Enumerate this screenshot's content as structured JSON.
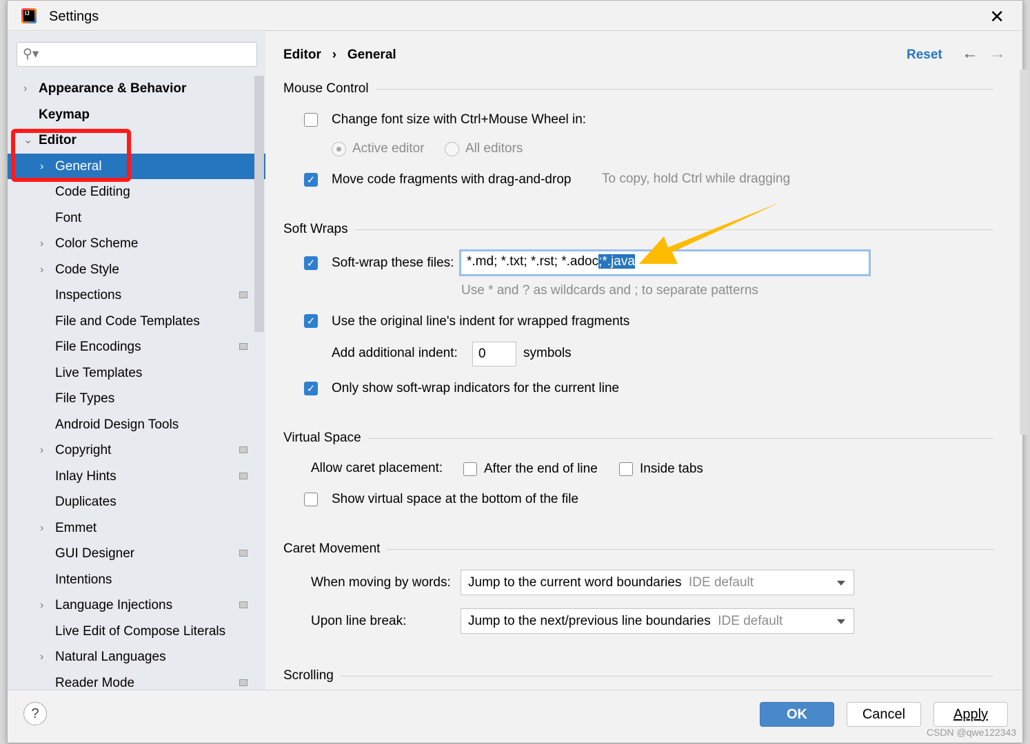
{
  "window": {
    "title": "Settings",
    "close": "✕",
    "logo_text": "IJ"
  },
  "sidebar": {
    "search_placeholder": "",
    "items": [
      {
        "label": "Appearance & Behavior",
        "level": 0,
        "bold": true,
        "arrow": "›"
      },
      {
        "label": "Keymap",
        "level": 0,
        "bold": true,
        "arrow": ""
      },
      {
        "label": "Editor",
        "level": 0,
        "bold": true,
        "arrow": "⌄"
      },
      {
        "label": "General",
        "level": 1,
        "arrow": "›",
        "selected": true
      },
      {
        "label": "Code Editing",
        "level": 1,
        "arrow": ""
      },
      {
        "label": "Font",
        "level": 1,
        "arrow": ""
      },
      {
        "label": "Color Scheme",
        "level": 1,
        "arrow": "›"
      },
      {
        "label": "Code Style",
        "level": 1,
        "arrow": "›"
      },
      {
        "label": "Inspections",
        "level": 1,
        "arrow": "",
        "project": true
      },
      {
        "label": "File and Code Templates",
        "level": 1,
        "arrow": ""
      },
      {
        "label": "File Encodings",
        "level": 1,
        "arrow": "",
        "project": true
      },
      {
        "label": "Live Templates",
        "level": 1,
        "arrow": ""
      },
      {
        "label": "File Types",
        "level": 1,
        "arrow": ""
      },
      {
        "label": "Android Design Tools",
        "level": 1,
        "arrow": ""
      },
      {
        "label": "Copyright",
        "level": 1,
        "arrow": "›",
        "project": true
      },
      {
        "label": "Inlay Hints",
        "level": 1,
        "arrow": "",
        "project": true
      },
      {
        "label": "Duplicates",
        "level": 1,
        "arrow": ""
      },
      {
        "label": "Emmet",
        "level": 1,
        "arrow": "›"
      },
      {
        "label": "GUI Designer",
        "level": 1,
        "arrow": "",
        "project": true
      },
      {
        "label": "Intentions",
        "level": 1,
        "arrow": ""
      },
      {
        "label": "Language Injections",
        "level": 1,
        "arrow": "›",
        "project": true
      },
      {
        "label": "Live Edit of Compose Literals",
        "level": 1,
        "arrow": ""
      },
      {
        "label": "Natural Languages",
        "level": 1,
        "arrow": "›"
      },
      {
        "label": "Reader Mode",
        "level": 1,
        "arrow": "",
        "project": true
      }
    ]
  },
  "header": {
    "crumb1": "Editor",
    "sep": "›",
    "crumb2": "General",
    "reset": "Reset",
    "back": "←",
    "forward": "→"
  },
  "mouse": {
    "title": "Mouse Control",
    "font_size": "Change font size with Ctrl+Mouse Wheel in:",
    "font_size_checked": false,
    "active_editor": "Active editor",
    "all_editors": "All editors",
    "drag": "Move code fragments with drag-and-drop",
    "drag_checked": true,
    "drag_hint": "To copy, hold Ctrl while dragging"
  },
  "wraps": {
    "title": "Soft Wraps",
    "label": "Soft-wrap these files:",
    "checked": true,
    "value": "*.md; *.txt; *.rst; *.adoc",
    "selected_value": ";*.java",
    "hint": "Use * and ? as wildcards and ; to separate patterns",
    "indent": "Use the original line's indent for wrapped fragments",
    "indent_checked": true,
    "add_indent": "Add additional indent:",
    "add_indent_value": "0",
    "symbols": "symbols",
    "indicators": "Only show soft-wrap indicators for the current line",
    "indicators_checked": true
  },
  "virtual": {
    "title": "Virtual Space",
    "caret": "Allow caret placement:",
    "end_line": "After the end of line",
    "inside_tabs": "Inside tabs",
    "bottom": "Show virtual space at the bottom of the file"
  },
  "caret": {
    "title": "Caret Movement",
    "words_label": "When moving by words:",
    "words_value": "Jump to the current word boundaries",
    "words_hint": "IDE default",
    "break_label": "Upon line break:",
    "break_value": "Jump to the next/previous line boundaries",
    "break_hint": "IDE default"
  },
  "scrolling": {
    "title": "Scrolling"
  },
  "footer": {
    "help": "?",
    "ok": "OK",
    "cancel": "Cancel",
    "apply": "Apply"
  },
  "watermark": "CSDN @qwe122343",
  "colors": {
    "accent": "#2675bf",
    "highlight": "#ff1a1a",
    "arrow": "#ffbb00"
  }
}
